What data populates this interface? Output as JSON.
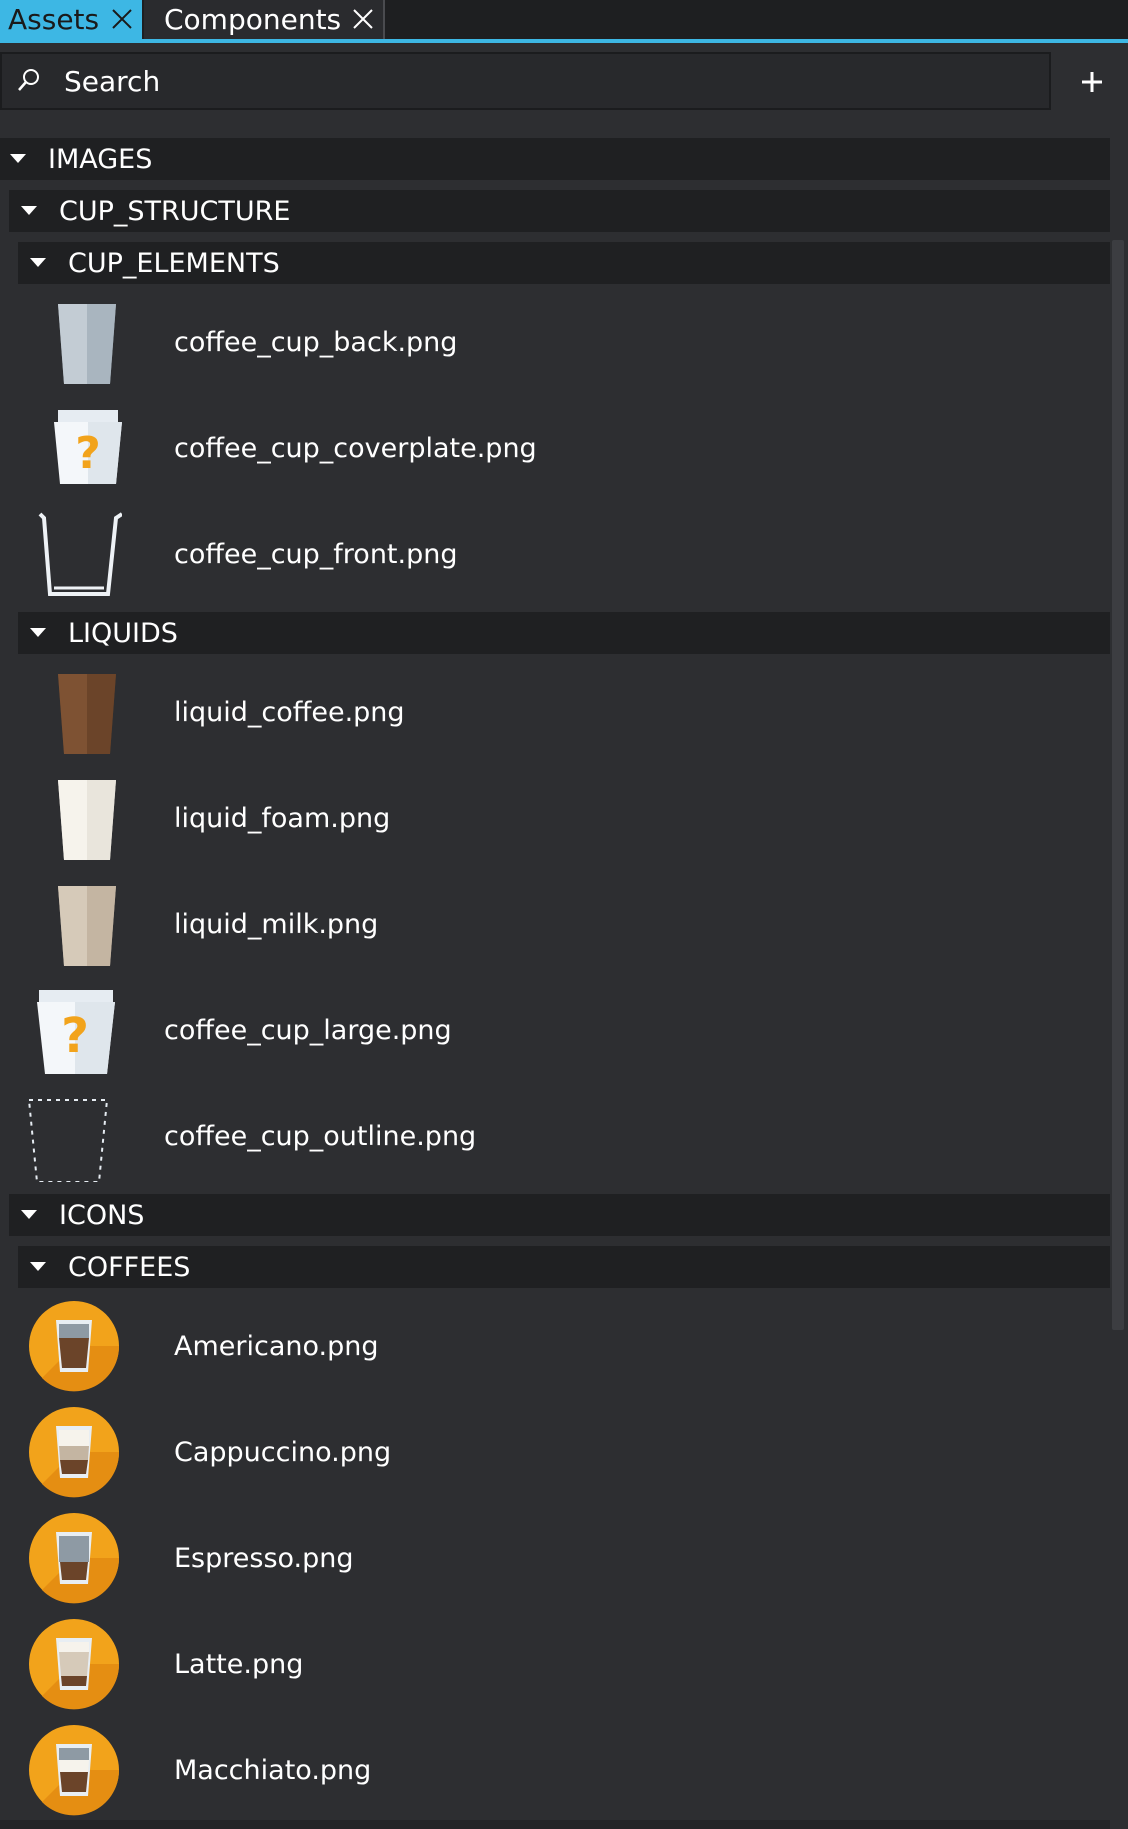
{
  "tabs": [
    {
      "label": "Assets",
      "active": true
    },
    {
      "label": "Components",
      "active": false
    }
  ],
  "search": {
    "placeholder": "Search"
  },
  "tree": {
    "images": {
      "label": "IMAGES",
      "cup_structure": {
        "label": "CUP_STRUCTURE",
        "cup_elements": {
          "label": "CUP_ELEMENTS",
          "items": [
            "coffee_cup_back.png",
            "coffee_cup_coverplate.png",
            "coffee_cup_front.png"
          ]
        },
        "liquids": {
          "label": "LIQUIDS",
          "items": [
            "liquid_coffee.png",
            "liquid_foam.png",
            "liquid_milk.png"
          ]
        }
      },
      "items": [
        "coffee_cup_large.png",
        "coffee_cup_outline.png"
      ]
    },
    "icons": {
      "label": "ICONS",
      "coffees": {
        "label": "COFFEES",
        "items": [
          "Americano.png",
          "Cappuccino.png",
          "Espresso.png",
          "Latte.png",
          "Macchiato.png"
        ]
      }
    }
  },
  "colors": {
    "accent": "#3db7e4",
    "background": "#2d2e31",
    "folder_header": "#1f2022",
    "icon_orange": "#f2a31b"
  }
}
